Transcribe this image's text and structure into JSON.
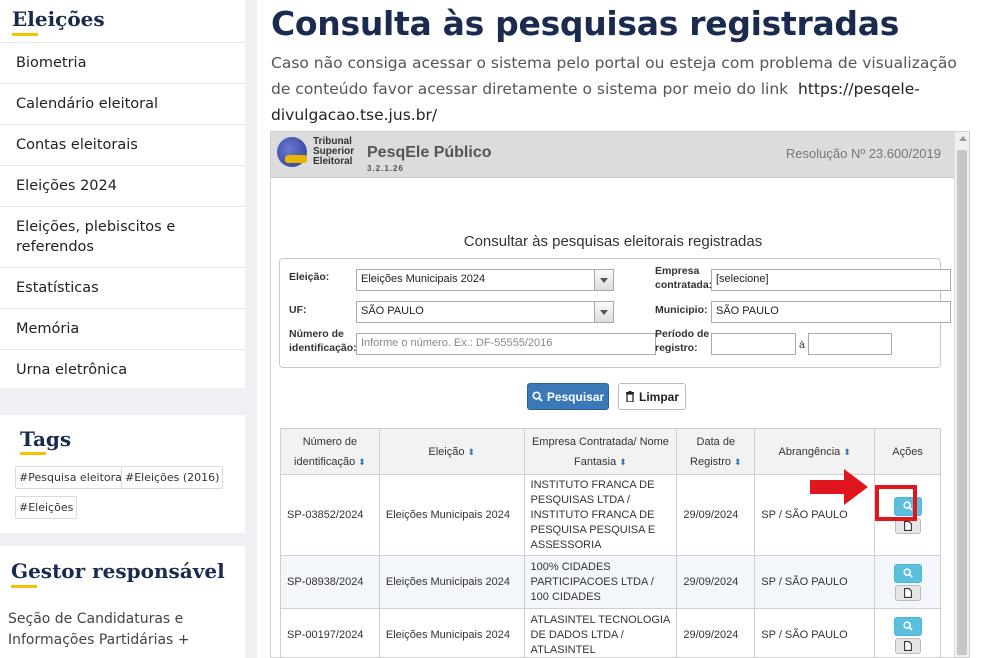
{
  "sidebar": {
    "elections_title": "Eleições",
    "menu": [
      {
        "label": "Biometria"
      },
      {
        "label": "Calendário eleitoral"
      },
      {
        "label": "Contas eleitorais"
      },
      {
        "label": "Eleições 2024"
      },
      {
        "label": "Eleições, plebiscitos e referendos"
      },
      {
        "label": "Estatísticas"
      },
      {
        "label": "Memória"
      },
      {
        "label": "Urna eletrônica"
      }
    ],
    "tags_title": "Tags",
    "tags": [
      "#Pesquisa eleitoral",
      "#Eleições (2016)",
      "#Eleições"
    ],
    "gestor_title": "Gestor responsável",
    "gestor_text": "Seção de Candidaturas e Informações Partidárias +"
  },
  "main": {
    "title": "Consulta às pesquisas registradas",
    "description": "Caso não consiga acessar o sistema pelo portal ou esteja com problema de visualização de conteúdo favor acessar diretamente o sistema por meio do link",
    "link_text": "https://pesqele-divulgacao.tse.jus.br/"
  },
  "app": {
    "org_line1": "Tribunal",
    "org_line2": "Superior",
    "org_line3": "Eleitoral",
    "title": "PesqEle Público",
    "version": "3.2.1.26",
    "resolution": "Resolução Nº 23.600/2019",
    "form_title": "Consultar às pesquisas eleitorais registradas",
    "form": {
      "eleicao_label": "Eleição:",
      "eleicao_value": "Eleições Municipais 2024",
      "empresa_label": "Empresa contratada:",
      "empresa_value": "[selecione]",
      "uf_label": "UF:",
      "uf_value": "SÃO PAULO",
      "municipio_label": "Municipio:",
      "municipio_value": "SÃO PAULO",
      "numero_label": "Número de identificação:",
      "numero_placeholder": "Informe o número. Ex.: DF-55555/2016",
      "periodo_label": "Período de registro:",
      "periodo_sep": "à"
    },
    "search_label": "Pesquisar",
    "clear_label": "Limpar",
    "table": {
      "headers": [
        "Número de identificação",
        "Eleição",
        "Empresa Contratada/ Nome Fantasia",
        "Data de Registro",
        "Abrangência",
        "Ações"
      ],
      "rows": [
        {
          "numero": "SP-03852/2024",
          "eleicao": "Eleições Municipais 2024",
          "empresa": "INSTITUTO FRANCA DE PESQUISAS LTDA / INSTITUTO FRANCA DE PESQUISA PESQUISA E ASSESSORIA",
          "data": "29/09/2024",
          "abrangencia": "SP / SÃO PAULO"
        },
        {
          "numero": "SP-08938/2024",
          "eleicao": "Eleições Municipais 2024",
          "empresa": "100% CIDADES PARTICIPACOES LTDA / 100 CIDADES",
          "data": "29/09/2024",
          "abrangencia": "SP / SÃO PAULO"
        },
        {
          "numero": "SP-00197/2024",
          "eleicao": "Eleições Municipais 2024",
          "empresa": "ATLASINTEL TECNOLOGIA DE DADOS LTDA / ATLASINTEL",
          "data": "29/09/2024",
          "abrangencia": "SP / SÃO PAULO"
        }
      ]
    }
  }
}
